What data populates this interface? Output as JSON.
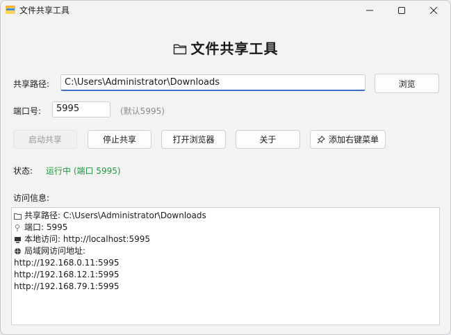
{
  "window": {
    "title": "文件共享工具",
    "icons": {
      "app": "folder-app-icon",
      "minimize": "minimize-icon",
      "maximize": "maximize-icon",
      "close": "close-icon"
    }
  },
  "header": {
    "title": "文件共享工具",
    "icon": "folder-icon"
  },
  "form": {
    "path_label": "共享路径:",
    "path_value": "C:\\Users\\Administrator\\Downloads",
    "browse_label": "浏览",
    "port_label": "端口号:",
    "port_value": "5995",
    "port_hint": "(默认5995)"
  },
  "actions": {
    "start": "启动共享",
    "stop": "停止共享",
    "open_browser": "打开浏览器",
    "about": "关于",
    "add_context_menu": "添加右键菜单"
  },
  "status": {
    "label": "状态:",
    "value": "运行中 (端口 5995)",
    "color": "#1e9a3a"
  },
  "info": {
    "label": "访问信息:",
    "lines": [
      {
        "icon": "folder-icon",
        "text": "共享路径: C:\\Users\\Administrator\\Downloads"
      },
      {
        "icon": "pin-icon",
        "text": "端口: 5995"
      },
      {
        "icon": "computer-icon",
        "text": "本地访问: http://localhost:5995"
      },
      {
        "icon": "globe-icon",
        "text": "局域网访问地址:"
      },
      {
        "icon": "",
        "text": "http://192.168.0.11:5995"
      },
      {
        "icon": "",
        "text": "http://192.168.12.1:5995"
      },
      {
        "icon": "",
        "text": "http://192.168.79.1:5995"
      }
    ]
  }
}
